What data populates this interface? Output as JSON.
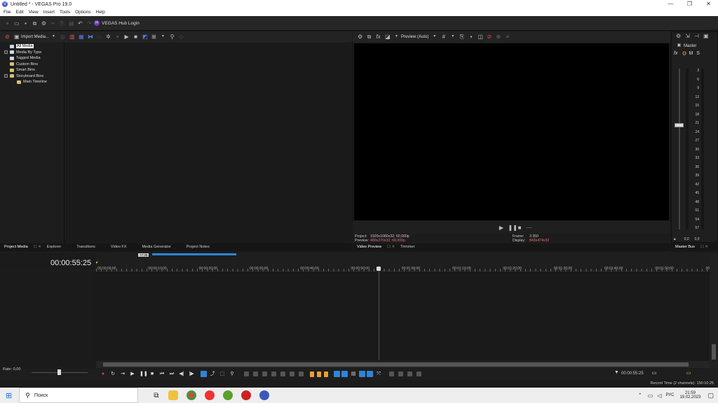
{
  "window": {
    "title": "Untitled * - VEGAS Pro 19.0",
    "logo_letter": "V",
    "minimize": "—",
    "maximize": "❐",
    "close": "✕"
  },
  "menu": [
    "File",
    "Edit",
    "View",
    "Insert",
    "Tools",
    "Options",
    "Help"
  ],
  "toolbar": {
    "hub_label": "VEGAS Hub Login",
    "hub_letter": "H"
  },
  "project_media": {
    "import_label": "Import Media...",
    "tree": [
      {
        "label": "All Media",
        "selected": true,
        "indent": 0
      },
      {
        "label": "Media By Type",
        "selected": false,
        "indent": 0
      },
      {
        "label": "Tagged Media",
        "selected": false,
        "indent": 0
      },
      {
        "label": "Custom Bins",
        "selected": false,
        "indent": 0
      },
      {
        "label": "Smart Bins",
        "selected": false,
        "indent": 0
      },
      {
        "label": "Storyboard Bins",
        "selected": false,
        "indent": 0
      },
      {
        "label": "Main Timeline",
        "selected": false,
        "indent": 1
      }
    ]
  },
  "left_tabs": [
    "Project Media",
    "Explorer",
    "Transitions",
    "Video FX",
    "Media Generator",
    "Project Notes"
  ],
  "preview": {
    "mode_label": "Preview (Auto)",
    "project_label": "Project:",
    "project_value": "1920x1080x32; 60,000p",
    "preview_label": "Preview:",
    "preview_value": "480x270x32; 60,000p",
    "frame_label": "Frame:",
    "frame_value": "3 350",
    "display_label": "Display:",
    "display_value": "843x474x32"
  },
  "mid_tabs": [
    "Video Preview",
    "Trimmer"
  ],
  "master": {
    "label": "Master",
    "fx": "fx",
    "m": "M",
    "s": "S",
    "scale": [
      "3",
      "6",
      "9",
      "12",
      "15",
      "18",
      "21",
      "24",
      "27",
      "30",
      "33",
      "36",
      "39",
      "42",
      "45",
      "48",
      "51",
      "54",
      "57"
    ],
    "val_left": "0,0",
    "val_right": "0,0"
  },
  "right_tabs": [
    "Master Bus"
  ],
  "timeline": {
    "timecode": "00:00:55:25",
    "region_label": "+7:28",
    "ruler": [
      "00:00:00;00",
      "00:00:10;00",
      "00:00:20;00",
      "00:00:30;00",
      "00:00:40;00",
      "00:00:50;00",
      "00:01:00;00",
      "00:01:10;00",
      "00:01:20;00",
      "00:01:30;00",
      "00:01:40;00",
      "00:01:50;00",
      "00:02:00;00"
    ],
    "rate_label": "Rate: 0,00",
    "transport_timecode": "00:00:55:25",
    "record_time": "Record Time (2 channels): 150:10:25"
  },
  "taskbar": {
    "search_placeholder": "Поиск",
    "lang": "РУС",
    "time": "21:59",
    "date": "19.02.2023"
  },
  "colors": {
    "accent_blue": "#2e84d6",
    "marker_orange": "#e8a033",
    "folder_yellow": "#d6c06a"
  }
}
